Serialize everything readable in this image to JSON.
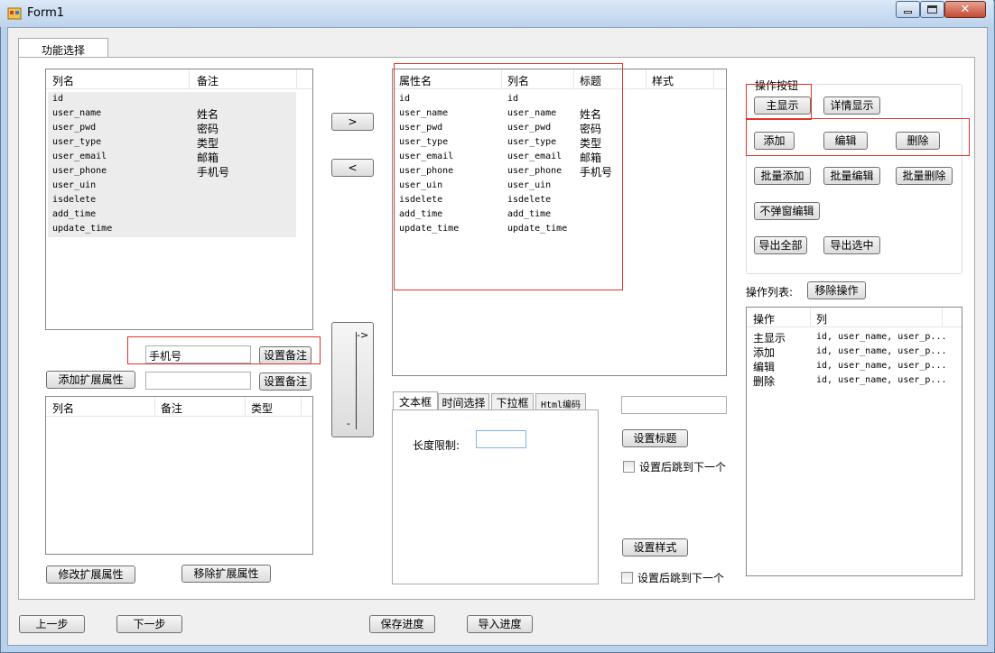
{
  "window": {
    "title": "Form1"
  },
  "tab": {
    "label": "功能选择"
  },
  "left_list": {
    "headers": [
      "列名",
      "备注"
    ],
    "rows": [
      [
        "id",
        ""
      ],
      [
        "user_name",
        "姓名"
      ],
      [
        "user_pwd",
        "密码"
      ],
      [
        "user_type",
        "类型"
      ],
      [
        "user_email",
        "邮箱"
      ],
      [
        "user_phone",
        "手机号"
      ],
      [
        "user_uin",
        ""
      ],
      [
        "isdelete",
        ""
      ],
      [
        "add_time",
        ""
      ],
      [
        "update_time",
        ""
      ]
    ]
  },
  "remark": {
    "value": "手机号",
    "set_label": "设置备注"
  },
  "ext": {
    "add_label": "添加扩展属性",
    "input_value": "",
    "set_label": "设置备注",
    "headers": [
      "列名",
      "备注",
      "类型"
    ],
    "modify_label": "修改扩展属性",
    "remove_label": "移除扩展属性"
  },
  "arrows": {
    "right": ">",
    "left": "<",
    "top_glyph": "->",
    "bottom_glyph": "-"
  },
  "prop_list": {
    "headers": [
      "属性名",
      "列名",
      "标题",
      "样式"
    ],
    "rows": [
      [
        "id",
        "id",
        "",
        ""
      ],
      [
        "user_name",
        "user_name",
        "姓名",
        ""
      ],
      [
        "user_pwd",
        "user_pwd",
        "密码",
        ""
      ],
      [
        "user_type",
        "user_type",
        "类型",
        ""
      ],
      [
        "user_email",
        "user_email",
        "邮箱",
        ""
      ],
      [
        "user_phone",
        "user_phone",
        "手机号",
        ""
      ],
      [
        "user_uin",
        "user_uin",
        "",
        ""
      ],
      [
        "isdelete",
        "isdelete",
        "",
        ""
      ],
      [
        "add_time",
        "add_time",
        "",
        ""
      ],
      [
        "update_time",
        "update_time",
        "",
        ""
      ]
    ]
  },
  "style_tabs": {
    "tabs": [
      "文本框",
      "时间选择",
      "下拉框",
      "Html编码"
    ],
    "length_label": "长度限制:",
    "length_value": ""
  },
  "title_setting": {
    "input_value": "",
    "set_title_label": "设置标题",
    "jump_label_1": "设置后跳到下一个",
    "set_style_label": "设置样式",
    "jump_label_2": "设置后跳到下一个"
  },
  "op_buttons": {
    "group_label": "操作按钮",
    "main_display": "主显示",
    "detail_display": "详情显示",
    "add": "添加",
    "edit": "编辑",
    "delete": "删除",
    "batch_add": "批量添加",
    "batch_edit": "批量编辑",
    "batch_delete": "批量删除",
    "no_popup_edit": "不弹窗编辑",
    "export_all": "导出全部",
    "export_selected": "导出选中"
  },
  "op_list": {
    "label": "操作列表:",
    "remove_label": "移除操作",
    "headers": [
      "操作",
      "列"
    ],
    "rows": [
      [
        "主显示",
        "id, user_name, user_p..."
      ],
      [
        "添加",
        "id, user_name, user_p..."
      ],
      [
        "编辑",
        "id, user_name, user_p..."
      ],
      [
        "删除",
        "id, user_name, user_p..."
      ]
    ]
  },
  "footer": {
    "prev": "上一步",
    "next": "下一步",
    "save": "保存进度",
    "import": "导入进度"
  },
  "colors": {
    "highlight_red": "#e0332a",
    "list_selection_gray": "#ececec"
  }
}
